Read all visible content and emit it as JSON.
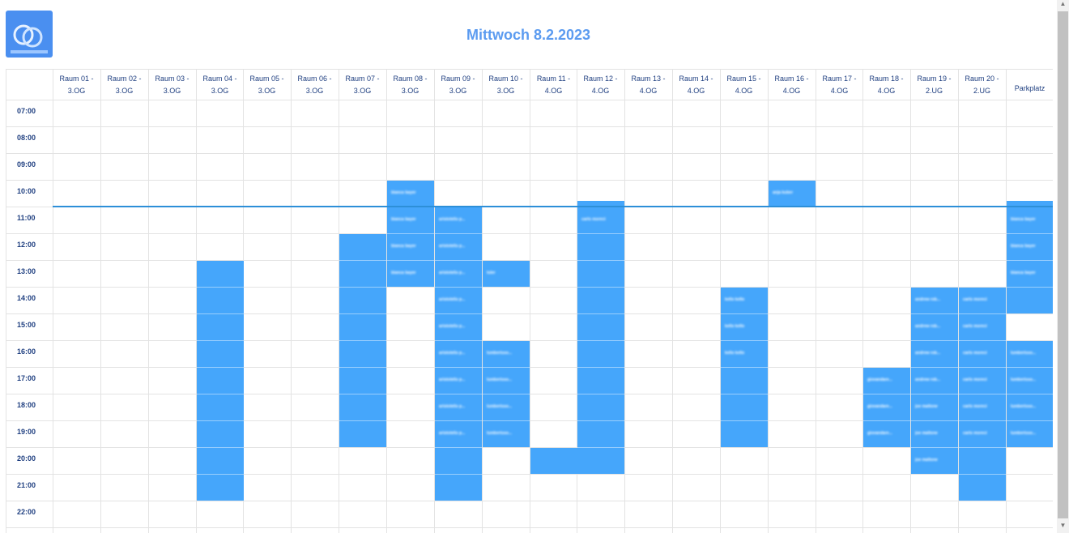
{
  "page": {
    "title": "Mittwoch 8.2.2023"
  },
  "columns": [
    "Raum 01 -\n3.OG",
    "Raum 02 -\n3.OG",
    "Raum 03 -\n3.OG",
    "Raum 04 -\n3.OG",
    "Raum 05 -\n3.OG",
    "Raum 06 -\n3.OG",
    "Raum 07 -\n3.OG",
    "Raum 08 -\n3.OG",
    "Raum 09 -\n3.OG",
    "Raum 10 -\n3.OG",
    "Raum 11 -\n4.OG",
    "Raum 12 -\n4.OG",
    "Raum 13 -\n4.OG",
    "Raum 14 -\n4.OG",
    "Raum 15 -\n4.OG",
    "Raum 16 -\n4.OG",
    "Raum 17 -\n4.OG",
    "Raum 18 -\n4.OG",
    "Raum 19 -\n2.UG",
    "Raum 20 -\n2.UG",
    "Parkplatz"
  ],
  "times": [
    "07:00",
    "08:00",
    "09:00",
    "10:00",
    "11:00",
    "12:00",
    "13:00",
    "14:00",
    "15:00",
    "16:00",
    "17:00",
    "18:00",
    "19:00",
    "20:00",
    "21:00",
    "22:00"
  ],
  "now": {
    "time": "11:00"
  },
  "bookings": [
    {
      "col": 3,
      "start": 13,
      "end": 22,
      "labels": []
    },
    {
      "col": 6,
      "start": 12,
      "end": 20,
      "labels": []
    },
    {
      "col": 7,
      "start": 10,
      "end": 14,
      "labels": [
        "bianca bayer",
        "bianca bayer",
        "bianca bayer",
        "bianca bayer"
      ]
    },
    {
      "col": 8,
      "start": 11,
      "end": 22,
      "labels": [
        "aristotelis p...",
        "aristotelis p...",
        "aristotelis p...",
        "aristotelis p...",
        "aristotelis p...",
        "aristotelis p...",
        "aristotelis p...",
        "aristotelis p...",
        "aristotelis p..."
      ]
    },
    {
      "col": 9,
      "start": 13,
      "end": 14,
      "labels": [
        "luler"
      ]
    },
    {
      "col": 9,
      "start": 16,
      "end": 20,
      "labels": [
        "lumbertsso...",
        "lumbertsso...",
        "lumbertsso...",
        "lumbertsso..."
      ]
    },
    {
      "col": 10,
      "start": 20,
      "end": 21,
      "labels": []
    },
    {
      "col": 11,
      "start": 10.75,
      "end": 21,
      "labels": [
        "carlo moreci"
      ]
    },
    {
      "col": 14,
      "start": 14,
      "end": 20,
      "labels": [
        "kello kello",
        "kello kello",
        "kello kello"
      ]
    },
    {
      "col": 15,
      "start": 10,
      "end": 11,
      "labels": [
        "anja kuber"
      ]
    },
    {
      "col": 17,
      "start": 17,
      "end": 20,
      "labels": [
        "giovandare...",
        "giovandare...",
        "giovandare..."
      ]
    },
    {
      "col": 18,
      "start": 14,
      "end": 21,
      "labels": [
        "andrew rob...",
        "andrew rob...",
        "andrew rob...",
        "andrew rob...",
        "joe maltone",
        "joe maltone",
        "joe maltone"
      ]
    },
    {
      "col": 19,
      "start": 14,
      "end": 22,
      "labels": [
        "carlo moreci",
        "carlo moreci",
        "carlo moreci",
        "carlo moreci",
        "carlo moreci",
        "carlo moreci"
      ]
    },
    {
      "col": 20,
      "start": 10.75,
      "end": 15,
      "labels": [
        "bianca bayer",
        "bianca bayer",
        "bianca bayer"
      ]
    },
    {
      "col": 20,
      "start": 16,
      "end": 20,
      "labels": [
        "lumbertsso...",
        "lumbertsso...",
        "lumbertsso...",
        "lumbertsso..."
      ]
    }
  ],
  "colors": {
    "booking": "#45a6fb",
    "title": "#5b9bf0",
    "now_line": "#2d8fd8"
  }
}
